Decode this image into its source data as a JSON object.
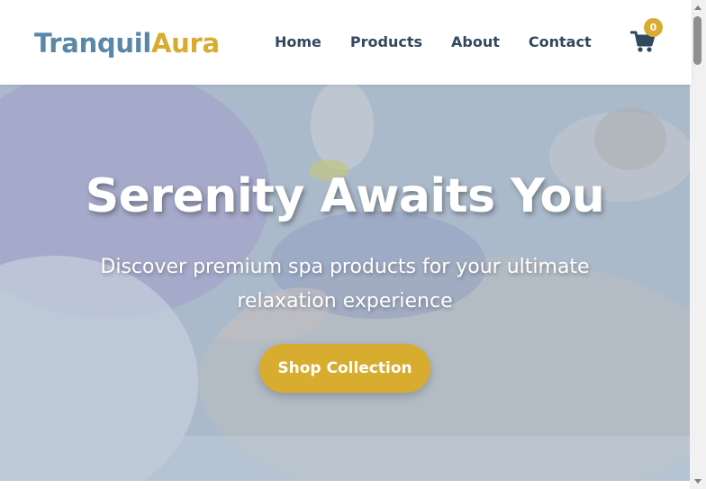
{
  "brand": {
    "part1": "Tranquil",
    "part2": "Aura"
  },
  "nav": {
    "items": [
      {
        "label": "Home"
      },
      {
        "label": "Products"
      },
      {
        "label": "About"
      },
      {
        "label": "Contact"
      }
    ]
  },
  "cart": {
    "count": "0",
    "icon": "shopping-cart-icon"
  },
  "hero": {
    "title": "Serenity Awaits You",
    "subtitle": "Discover premium spa products for your ultimate relaxation experience",
    "cta_label": "Shop Collection"
  },
  "colors": {
    "brand_blue": "#5a87a8",
    "brand_gold": "#d9ab2f",
    "nav_text": "#33485e",
    "button_bg": "#d8ac2f"
  }
}
